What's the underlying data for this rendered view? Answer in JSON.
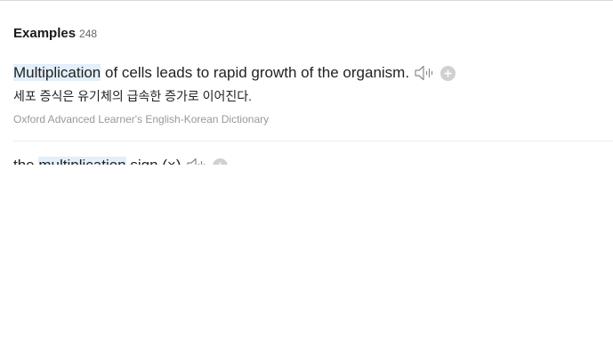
{
  "examples": {
    "title": "Examples",
    "count": "248",
    "items": [
      {
        "sentence_highlight": "Multiplication",
        "sentence_rest": " of cells leads to rapid growth of the organism.",
        "translation": "세포 증식은 유기체의 급속한 증가로 이어진다.",
        "source": "Oxford Advanced Learner's English-Korean Dictionary",
        "icons": [
          "speaker-icon",
          "add-icon"
        ]
      },
      {
        "sentence_prefix": "the ",
        "sentence_highlight": "multiplication",
        "sentence_rest": " sign (×)",
        "icons": [
          "speaker-icon",
          "add-icon"
        ]
      }
    ]
  },
  "colors": {
    "highlight": "#e3effa",
    "source_text": "#999999",
    "add_button": "#d0d0d0"
  }
}
